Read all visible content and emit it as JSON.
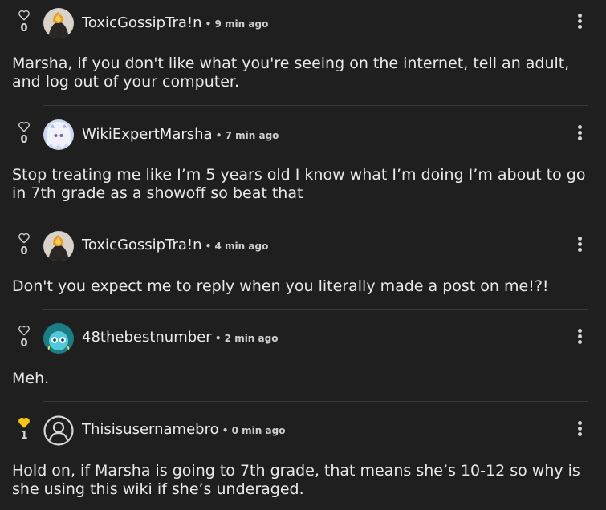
{
  "comments": [
    {
      "likes": "0",
      "liked": false,
      "username": "ToxicGossipTra!n",
      "time": " • 9 min ago",
      "avatar_icon": "flame-avatar",
      "text": "Marsha, if you don't like what you're seeing on the internet, tell an adult, and log out of your computer."
    },
    {
      "likes": "0",
      "liked": false,
      "username": "WikiExpertMarsha",
      "time": " • 7 min ago",
      "avatar_icon": "anime-avatar",
      "text": "Stop treating me like I’m 5 years old I know what I’m doing I’m about to go in 7th grade as a showoff so beat that"
    },
    {
      "likes": "0",
      "liked": false,
      "username": "ToxicGossipTra!n",
      "time": " • 4 min ago",
      "avatar_icon": "flame-avatar",
      "text": "Don't you expect me to reply when you literally made a post on me!?!"
    },
    {
      "likes": "0",
      "liked": false,
      "username": "48thebestnumber",
      "time": " • 2 min ago",
      "avatar_icon": "teal-creature-avatar",
      "text": "Meh."
    },
    {
      "likes": "1",
      "liked": true,
      "username": "Thisisusernamebro",
      "time": " • 0 min ago",
      "avatar_icon": "default-user-avatar",
      "text": "Hold on, if Marsha is going to 7th grade, that means she’s 10-12 so why is she using this wiki if she’s underaged."
    }
  ],
  "colors": {
    "background": "#1f1f1f",
    "liked_heart": "#f5c518",
    "text": "#e9e9e9",
    "divider": "#3a3a3a"
  }
}
